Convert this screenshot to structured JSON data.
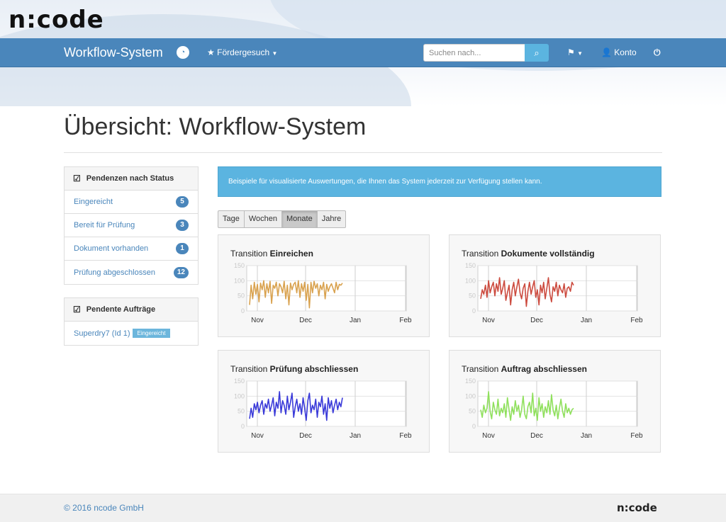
{
  "app": {
    "logo": "n:code",
    "brand": "Workflow-System"
  },
  "navbar": {
    "menu_label": "Fördergesuch",
    "search_placeholder": "Suchen nach...",
    "account_label": "Konto"
  },
  "page": {
    "title": "Übersicht: Workflow-System"
  },
  "sidebar": {
    "status_panel": {
      "title": "Pendenzen nach Status",
      "items": [
        {
          "label": "Eingereicht",
          "count": "5"
        },
        {
          "label": "Bereit für Prüfung",
          "count": "3"
        },
        {
          "label": "Dokument vorhanden",
          "count": "1"
        },
        {
          "label": "Prüfung abgeschlossen",
          "count": "12"
        }
      ]
    },
    "orders_panel": {
      "title": "Pendente Aufträge",
      "items": [
        {
          "label": "Superdry7 (Id 1)",
          "status": "Eingereicht"
        }
      ]
    }
  },
  "info": {
    "text": "Beispiele für visualisierte Auswertungen, die Ihnen das System jederzeit zur Verfügung stellen kann."
  },
  "period_buttons": {
    "tage": "Tage",
    "wochen": "Wochen",
    "monate": "Monate",
    "jahre": "Jahre",
    "active": "Monate"
  },
  "charts": [
    {
      "prefix": "Transition ",
      "name": "Einreichen"
    },
    {
      "prefix": "Transition ",
      "name": "Dokumente vollständig"
    },
    {
      "prefix": "Transition ",
      "name": "Prüfung abschliessen"
    },
    {
      "prefix": "Transition ",
      "name": "Auftrag abschliessen"
    }
  ],
  "chart_data": [
    {
      "type": "line",
      "title": "Transition Einreichen",
      "x_ticks": [
        "Nov",
        "Dec",
        "Jan",
        "Feb"
      ],
      "y_ticks": [
        0,
        50,
        100,
        150
      ],
      "ylim": [
        0,
        150
      ],
      "grid": true,
      "color": "#d9a24f",
      "series": [
        {
          "values": [
            20,
            85,
            40,
            95,
            55,
            88,
            30,
            92,
            70,
            100,
            45,
            90,
            60,
            98,
            25,
            85,
            75,
            95,
            50,
            90,
            80,
            60,
            98,
            40,
            85,
            20,
            92,
            70,
            88,
            95,
            60,
            100,
            45,
            90,
            65,
            95,
            35,
            88,
            10,
            95,
            60,
            98,
            75,
            90,
            50,
            85,
            70,
            95,
            40,
            88,
            65,
            80,
            90,
            75,
            60,
            95,
            70,
            88,
            85,
            92
          ]
        }
      ]
    },
    {
      "type": "line",
      "title": "Transition Dokumente vollständig",
      "x_ticks": [
        "Nov",
        "Dec",
        "Jan",
        "Feb"
      ],
      "y_ticks": [
        0,
        50,
        100,
        150
      ],
      "ylim": [
        0,
        150
      ],
      "grid": true,
      "color": "#cc4b3f",
      "series": [
        {
          "values": [
            40,
            70,
            55,
            85,
            45,
            100,
            60,
            80,
            95,
            50,
            90,
            65,
            110,
            55,
            75,
            100,
            35,
            60,
            85,
            20,
            70,
            95,
            50,
            80,
            105,
            60,
            40,
            75,
            90,
            15,
            65,
            95,
            55,
            80,
            100,
            45,
            70,
            20,
            85,
            60,
            95,
            40,
            75,
            110,
            55,
            30,
            80,
            65,
            95,
            50,
            85,
            70,
            60,
            90,
            45,
            75,
            80,
            65,
            95,
            85
          ]
        }
      ]
    },
    {
      "type": "line",
      "title": "Transition Prüfung abschliessen",
      "x_ticks": [
        "Nov",
        "Dec",
        "Jan",
        "Feb"
      ],
      "y_ticks": [
        0,
        50,
        100,
        150
      ],
      "ylim": [
        0,
        150
      ],
      "grid": true,
      "color": "#3a3ad9",
      "series": [
        {
          "values": [
            25,
            60,
            30,
            75,
            55,
            80,
            45,
            70,
            85,
            40,
            75,
            60,
            90,
            50,
            70,
            95,
            35,
            80,
            60,
            115,
            45,
            85,
            70,
            40,
            100,
            55,
            80,
            110,
            30,
            65,
            90,
            50,
            75,
            40,
            95,
            60,
            20,
            85,
            110,
            45,
            70,
            55,
            90,
            30,
            80,
            65,
            100,
            40,
            75,
            20,
            95,
            60,
            85,
            45,
            70,
            90,
            55,
            80,
            65,
            95
          ]
        }
      ]
    },
    {
      "type": "line",
      "title": "Transition Auftrag abschliessen",
      "x_ticks": [
        "Nov",
        "Dec",
        "Jan",
        "Feb"
      ],
      "y_ticks": [
        0,
        50,
        100,
        150
      ],
      "ylim": [
        0,
        150
      ],
      "grid": true,
      "color": "#8fe05c",
      "series": [
        {
          "values": [
            55,
            30,
            70,
            45,
            60,
            115,
            50,
            25,
            80,
            55,
            40,
            90,
            35,
            60,
            45,
            75,
            30,
            95,
            55,
            20,
            65,
            40,
            85,
            50,
            70,
            30,
            55,
            100,
            40,
            25,
            65,
            80,
            45,
            110,
            35,
            60,
            20,
            95,
            50,
            75,
            30,
            65,
            45,
            85,
            40,
            105,
            55,
            35,
            70,
            25,
            60,
            90,
            50,
            30,
            75,
            45,
            60,
            40,
            55,
            60
          ]
        }
      ]
    }
  ]
}
